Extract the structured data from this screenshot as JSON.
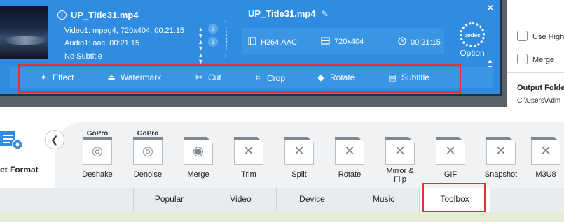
{
  "source": {
    "title": "UP_Title31.mp4",
    "video_line": "Video1: mpeg4, 720x404, 00:21:15",
    "video_count": "1",
    "audio_line": "Audio1: aac, 00:21:15",
    "audio_count": "1",
    "subtitle_line": "No Subtitle"
  },
  "output": {
    "title": "UP_Title31.mp4",
    "codec": "H264,AAC",
    "resolution": "720x404",
    "duration": "00:21:15"
  },
  "codec_button": {
    "icon_text": "codec",
    "label": "Option"
  },
  "toolbar": [
    {
      "label": "Effect",
      "icon": "magic-wand-icon"
    },
    {
      "label": "Watermark",
      "icon": "stamp-icon"
    },
    {
      "label": "Cut",
      "icon": "scissors-icon"
    },
    {
      "label": "Crop",
      "icon": "crop-icon"
    },
    {
      "label": "Rotate",
      "icon": "rotate-icon"
    },
    {
      "label": "Subtitle",
      "icon": "subtitle-icon"
    }
  ],
  "right_panel": {
    "use_high_label": "Use High",
    "merge_label": "Merge",
    "output_folder_label": "Output Folde",
    "output_folder_path": "C:\\Users\\Adm"
  },
  "target_format": {
    "label": "et Format"
  },
  "formats": [
    {
      "label": "Deshake",
      "badge": "GoPro",
      "icon": "camera-lens-icon"
    },
    {
      "label": "Denoise",
      "badge": "GoPro",
      "icon": "camera-lens-icon"
    },
    {
      "label": "Merge",
      "badge": "",
      "icon": "webcam-icon"
    },
    {
      "label": "Trim",
      "badge": "",
      "icon": "tools-icon"
    },
    {
      "label": "Split",
      "badge": "",
      "icon": "tools-icon"
    },
    {
      "label": "Rotate",
      "badge": "",
      "icon": "tools-icon"
    },
    {
      "label": "Mirror &\nFlip",
      "badge": "",
      "icon": "tools-icon"
    },
    {
      "label": "GIF",
      "badge": "",
      "icon": "tools-icon"
    },
    {
      "label": "Snapshot",
      "badge": "",
      "icon": "tools-icon"
    },
    {
      "label": "M3U8",
      "badge": "",
      "icon": "tools-icon"
    }
  ],
  "tabs": [
    {
      "label": "Popular"
    },
    {
      "label": "Video"
    },
    {
      "label": "Device"
    },
    {
      "label": "Music"
    },
    {
      "label": "Toolbox"
    }
  ],
  "active_tab": "Toolbox",
  "colors": {
    "accent": "#2f8ce0",
    "highlight_box": "#e0313a"
  }
}
